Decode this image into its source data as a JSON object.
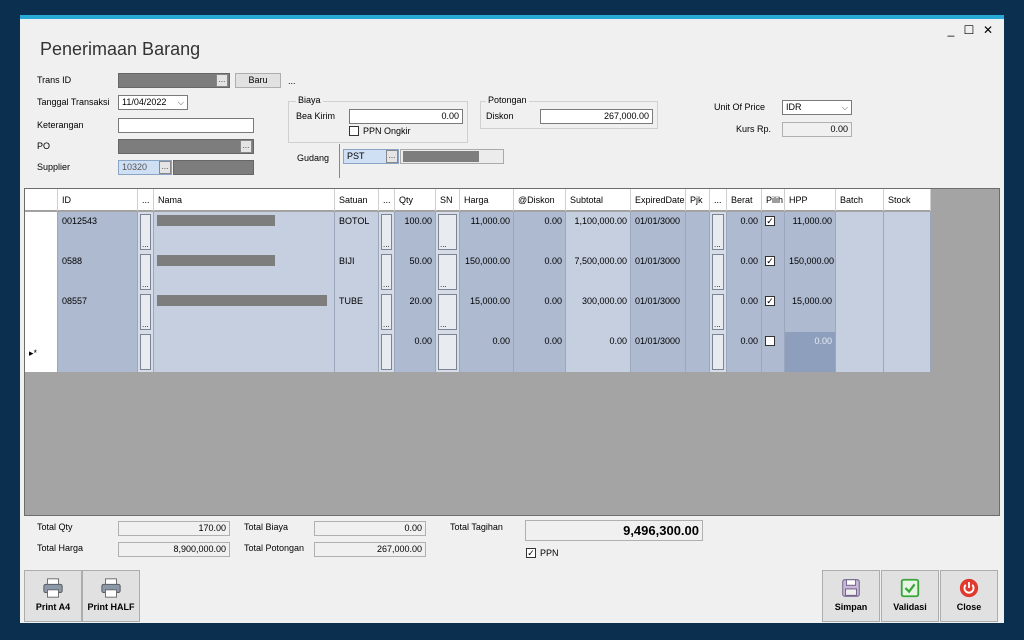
{
  "window": {
    "title": "Penerimaan Barang",
    "minimize": "_",
    "maximize": "☐",
    "close": "✕"
  },
  "form": {
    "trans_id_label": "Trans ID",
    "ellipsis": "...",
    "baru_label": "Baru",
    "extra_dots": "...",
    "tanggal_label": "Tanggal Transaksi",
    "tanggal_value": "11/04/2022",
    "keterangan_label": "Keterangan",
    "keterangan_value": "",
    "po_label": "PO",
    "supplier_label": "Supplier",
    "supplier_code": "10320"
  },
  "biaya": {
    "group_label": "Biaya",
    "bea_kirim_label": "Bea Kirim",
    "bea_kirim_value": "0.00",
    "ppn_ongkir_label": "PPN Ongkir",
    "ppn_ongkir_checked": false
  },
  "potongan": {
    "group_label": "Potongan",
    "diskon_label": "Diskon",
    "diskon_value": "267,000.00"
  },
  "gudang": {
    "label": "Gudang",
    "value": "PST"
  },
  "currency": {
    "unit_label": "Unit Of Price",
    "unit_value": "IDR",
    "kurs_label": "Kurs Rp.",
    "kurs_value": "0.00"
  },
  "grid": {
    "columns": [
      "ID",
      "...",
      "Nama",
      "Satuan",
      "...",
      "Qty",
      "SN",
      "Harga",
      "@Diskon",
      "Subtotal",
      "ExpiredDate",
      "Pjk",
      "...",
      "Berat",
      "Pilih",
      "HPP",
      "Batch",
      "Stock"
    ],
    "rows": [
      {
        "id": "0012543",
        "satuan": "BOTOL",
        "qty": "100.00",
        "harga": "11,000.00",
        "diskon": "0.00",
        "subtotal": "1,100,000.00",
        "expired": "01/01/3000",
        "berat": "0.00",
        "pilih": true,
        "hpp": "11,000.00"
      },
      {
        "id": "0588",
        "satuan": "BIJI",
        "qty": "50.00",
        "harga": "150,000.00",
        "diskon": "0.00",
        "subtotal": "7,500,000.00",
        "expired": "01/01/3000",
        "berat": "0.00",
        "pilih": true,
        "hpp": "150,000.00"
      },
      {
        "id": "08557",
        "satuan": "TUBE",
        "qty": "20.00",
        "harga": "15,000.00",
        "diskon": "0.00",
        "subtotal": "300,000.00",
        "expired": "01/01/3000",
        "berat": "0.00",
        "pilih": true,
        "hpp": "15,000.00"
      }
    ],
    "new_row": {
      "marker": "▸*",
      "qty": "0.00",
      "harga": "0.00",
      "diskon": "0.00",
      "subtotal": "0.00",
      "expired": "01/01/3000",
      "berat": "0.00",
      "pilih": false,
      "hpp": "0.00"
    }
  },
  "totals": {
    "total_qty_label": "Total Qty",
    "total_qty_value": "170.00",
    "total_harga_label": "Total Harga",
    "total_harga_value": "8,900,000.00",
    "total_biaya_label": "Total Biaya",
    "total_biaya_value": "0.00",
    "total_potongan_label": "Total Potongan",
    "total_potongan_value": "267,000.00",
    "total_tagihan_label": "Total Tagihan",
    "total_tagihan_value": "9,496,300.00",
    "ppn_label": "PPN",
    "ppn_checked": true
  },
  "buttons": {
    "print_a4": "Print A4",
    "print_half": "Print HALF",
    "simpan": "Simpan",
    "validasi": "Validasi",
    "close": "Close"
  },
  "colors": {
    "accent": "#29a9d6",
    "frame": "#0b2f4f",
    "validasi": "#3aa63a",
    "close": "#e03a2f"
  }
}
